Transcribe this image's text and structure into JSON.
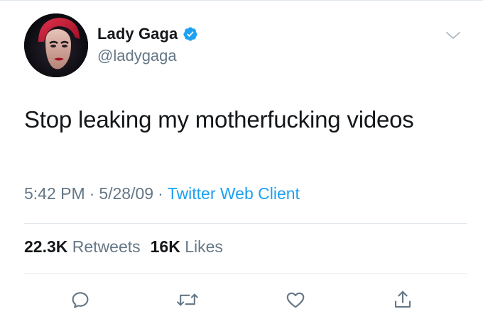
{
  "tweet": {
    "author": {
      "display_name": "Lady Gaga",
      "handle": "@ladygaga",
      "verified": true,
      "avatar_icon": "profile-photo"
    },
    "more_icon": "chevron-down-icon",
    "text": "Stop leaking my motherfucking videos",
    "meta": {
      "time": "5:42 PM",
      "separator": "·",
      "date": "5/28/09",
      "source": "Twitter Web Client"
    },
    "stats": {
      "retweets_count": "22.3K",
      "retweets_label": "Retweets",
      "likes_count": "16K",
      "likes_label": "Likes"
    },
    "actions": [
      {
        "name": "reply",
        "icon": "reply-icon"
      },
      {
        "name": "retweet",
        "icon": "retweet-icon"
      },
      {
        "name": "like",
        "icon": "heart-icon"
      },
      {
        "name": "share",
        "icon": "share-icon"
      }
    ]
  },
  "colors": {
    "text": "#14171a",
    "muted": "#657786",
    "link": "#1da1f2",
    "verified": "#1da1f2",
    "divider": "#e1e8ed"
  }
}
